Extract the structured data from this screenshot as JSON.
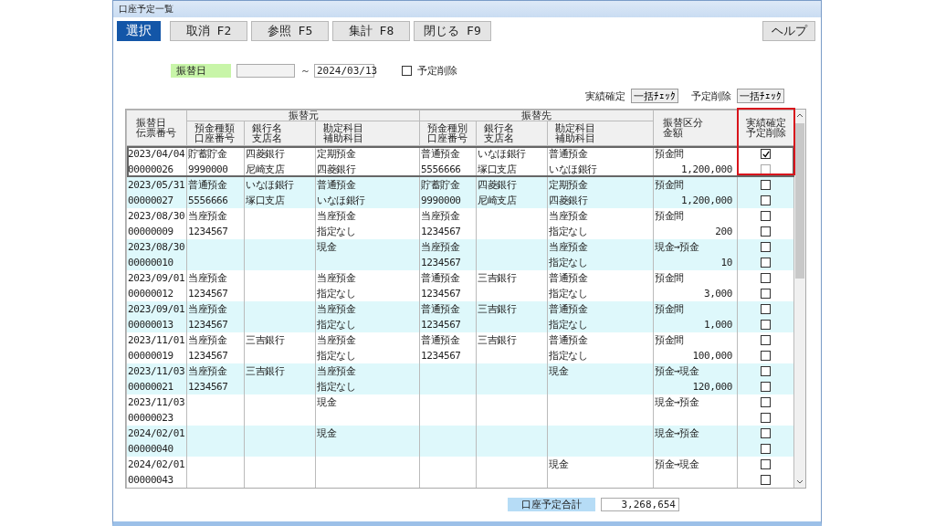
{
  "window": {
    "title": "口座予定一覧"
  },
  "toolbar": {
    "mode_label": "選択",
    "buttons": [
      "取消 F2",
      "参照 F5",
      "集計 F8",
      "閉じる F9"
    ],
    "help": "ヘルプ"
  },
  "filter": {
    "label": "振替日",
    "range_sep": "～",
    "date_to": "2024/03/13",
    "delete_checkbox": {
      "label": "予定削除",
      "checked": false
    }
  },
  "bulk": [
    {
      "label": "実績確定",
      "button": "一括ﾁｪｯｸ"
    },
    {
      "label": "予定削除",
      "button": "一括ﾁｪｯｸ"
    }
  ],
  "table": {
    "groups": [
      "振替元",
      "振替先"
    ],
    "heading_lines": [
      {
        "top": "振替日",
        "bottom": "伝票番号"
      },
      {
        "top": "預金種類",
        "bottom": "口座番号"
      },
      {
        "top": "銀行名",
        "bottom": "支店名"
      },
      {
        "top": "勘定科目",
        "bottom": "補助科目"
      },
      {
        "top": "預金種別",
        "bottom": "口座番号"
      },
      {
        "top": "銀行名",
        "bottom": "支店名"
      },
      {
        "top": "勘定科目",
        "bottom": "補助科目"
      },
      {
        "top": "振替区分",
        "bottom": "金額"
      },
      {
        "top": "実績確定",
        "bottom": "予定削除"
      }
    ],
    "highlight_frame": true,
    "rows": [
      {
        "selected": true,
        "cells": [
          [
            "2023/04/04",
            "00000026"
          ],
          [
            "貯蓄貯金",
            "9990000"
          ],
          [
            "四菱銀行",
            "尼崎支店"
          ],
          [
            "定期預金",
            "四菱銀行"
          ],
          [
            "普通預金",
            "5556666"
          ],
          [
            "いなほ銀行",
            "塚口支店"
          ],
          [
            "普通預金",
            "いなほ銀行"
          ],
          [
            "預金間",
            "1,200,000"
          ]
        ],
        "confirmed": {
          "checked": true,
          "disabled": false
        },
        "delete": {
          "checked": false,
          "disabled": true
        }
      },
      {
        "selected": false,
        "cells": [
          [
            "2023/05/31",
            "00000027"
          ],
          [
            "普通預金",
            "5556666"
          ],
          [
            "いなほ銀行",
            "塚口支店"
          ],
          [
            "普通預金",
            "いなほ銀行"
          ],
          [
            "貯蓄貯金",
            "9990000"
          ],
          [
            "四菱銀行",
            "尼崎支店"
          ],
          [
            "定期預金",
            "四菱銀行"
          ],
          [
            "預金間",
            "1,200,000"
          ]
        ],
        "confirmed": {
          "checked": false,
          "disabled": false
        },
        "delete": {
          "checked": false,
          "disabled": false
        }
      },
      {
        "selected": false,
        "cells": [
          [
            "2023/08/30",
            "00000009"
          ],
          [
            "当座預金",
            "1234567"
          ],
          [
            null,
            null
          ],
          [
            "当座預金",
            "指定なし"
          ],
          [
            "当座預金",
            "1234567"
          ],
          [
            null,
            null
          ],
          [
            "当座預金",
            "指定なし"
          ],
          [
            "預金間",
            "200"
          ]
        ],
        "confirmed": {
          "checked": false,
          "disabled": false
        },
        "delete": {
          "checked": false,
          "disabled": false
        }
      },
      {
        "selected": false,
        "cells": [
          [
            "2023/08/30",
            "00000010"
          ],
          [
            null,
            null
          ],
          [
            null,
            null
          ],
          [
            "現金",
            null
          ],
          [
            "当座預金",
            "1234567"
          ],
          [
            null,
            null
          ],
          [
            "当座預金",
            "指定なし"
          ],
          [
            "現金→預金",
            "10"
          ]
        ],
        "confirmed": {
          "checked": false,
          "disabled": false
        },
        "delete": {
          "checked": false,
          "disabled": false
        }
      },
      {
        "selected": false,
        "cells": [
          [
            "2023/09/01",
            "00000012"
          ],
          [
            "当座預金",
            "1234567"
          ],
          [
            null,
            null
          ],
          [
            "当座預金",
            "指定なし"
          ],
          [
            "普通預金",
            "1234567"
          ],
          [
            "三吉銀行",
            null
          ],
          [
            "普通預金",
            "指定なし"
          ],
          [
            "預金間",
            "3,000"
          ]
        ],
        "confirmed": {
          "checked": false,
          "disabled": false
        },
        "delete": {
          "checked": false,
          "disabled": false
        }
      },
      {
        "selected": false,
        "cells": [
          [
            "2023/09/01",
            "00000013"
          ],
          [
            "当座預金",
            "1234567"
          ],
          [
            null,
            null
          ],
          [
            "当座預金",
            "指定なし"
          ],
          [
            "普通預金",
            "1234567"
          ],
          [
            "三吉銀行",
            null
          ],
          [
            "普通預金",
            "指定なし"
          ],
          [
            "預金間",
            "1,000"
          ]
        ],
        "confirmed": {
          "checked": false,
          "disabled": false
        },
        "delete": {
          "checked": false,
          "disabled": false
        }
      },
      {
        "selected": false,
        "cells": [
          [
            "2023/11/01",
            "00000019"
          ],
          [
            "当座預金",
            "1234567"
          ],
          [
            "三吉銀行",
            null
          ],
          [
            "当座預金",
            "指定なし"
          ],
          [
            "普通預金",
            "1234567"
          ],
          [
            "三吉銀行",
            null
          ],
          [
            "普通預金",
            "指定なし"
          ],
          [
            "預金間",
            "100,000"
          ]
        ],
        "confirmed": {
          "checked": false,
          "disabled": false
        },
        "delete": {
          "checked": false,
          "disabled": false
        }
      },
      {
        "selected": false,
        "cells": [
          [
            "2023/11/03",
            "00000021"
          ],
          [
            "当座預金",
            "1234567"
          ],
          [
            "三吉銀行",
            null
          ],
          [
            "当座預金",
            "指定なし"
          ],
          [
            null,
            null
          ],
          [
            null,
            null
          ],
          [
            "現金",
            null
          ],
          [
            "預金→現金",
            "120,000"
          ]
        ],
        "confirmed": {
          "checked": false,
          "disabled": false
        },
        "delete": {
          "checked": false,
          "disabled": false
        }
      },
      {
        "selected": false,
        "cells": [
          [
            "2023/11/03",
            "00000023"
          ],
          [
            null,
            null
          ],
          [
            null,
            null
          ],
          [
            "現金",
            null
          ],
          [
            null,
            null
          ],
          [
            null,
            null
          ],
          [
            null,
            null
          ],
          [
            "現金→預金",
            null
          ]
        ],
        "confirmed": {
          "checked": false,
          "disabled": false
        },
        "delete": {
          "checked": false,
          "disabled": false
        }
      },
      {
        "selected": false,
        "cells": [
          [
            "2024/02/01",
            "00000040"
          ],
          [
            null,
            null
          ],
          [
            null,
            null
          ],
          [
            "現金",
            null
          ],
          [
            null,
            null
          ],
          [
            null,
            null
          ],
          [
            null,
            null
          ],
          [
            "現金→預金",
            null
          ]
        ],
        "confirmed": {
          "checked": false,
          "disabled": false
        },
        "delete": {
          "checked": false,
          "disabled": false
        }
      },
      {
        "selected": false,
        "cells": [
          [
            "2024/02/01",
            "00000043"
          ],
          [
            null,
            null
          ],
          [
            null,
            null
          ],
          [
            null,
            null
          ],
          [
            null,
            null
          ],
          [
            null,
            null
          ],
          [
            "現金",
            null
          ],
          [
            "預金→現金",
            null
          ]
        ],
        "confirmed": {
          "checked": false,
          "disabled": false
        },
        "delete": {
          "checked": false,
          "disabled": false
        }
      }
    ]
  },
  "total": {
    "label": "口座予定合計",
    "value": "3,268,654"
  }
}
